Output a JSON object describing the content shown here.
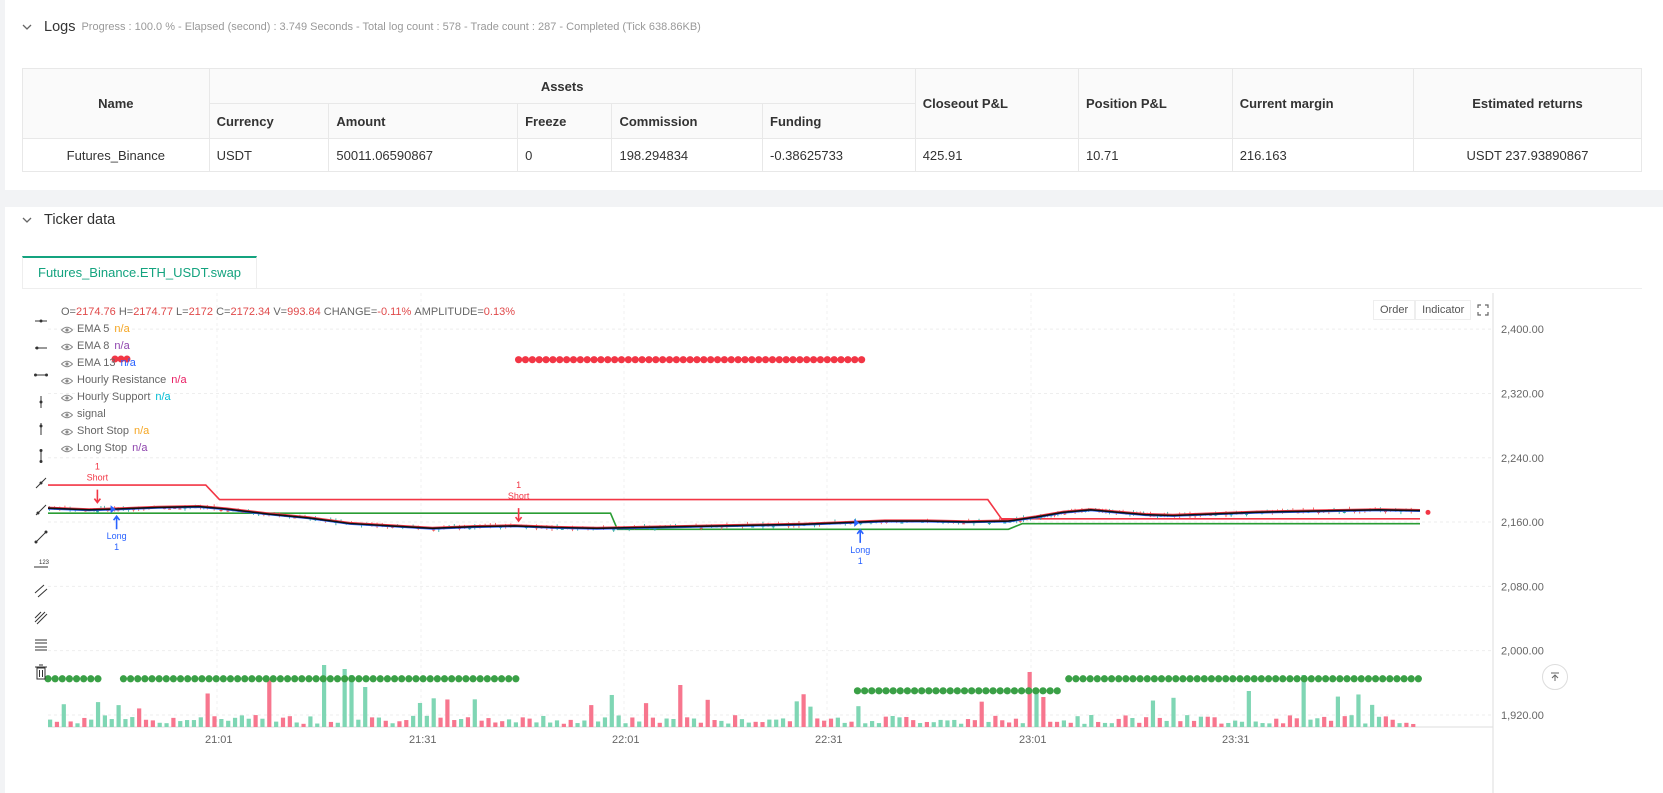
{
  "logs": {
    "title": "Logs",
    "meta": "Progress : 100.0 % - Elapsed (second) : 3.749  Seconds - Total log count : 578 - Trade count : 287 - Completed (Tick 638.86KB)",
    "table": {
      "name_header": "Name",
      "assets_header": "Assets",
      "sub_headers": [
        "Currency",
        "Amount",
        "Freeze",
        "Commission",
        "Funding"
      ],
      "closeout_header": "Closeout P&L",
      "position_header": "Position P&L",
      "margin_header": "Current margin",
      "returns_header": "Estimated returns",
      "row": {
        "name": "Futures_Binance",
        "currency": "USDT",
        "amount": "50011.06590867",
        "freeze": "0",
        "commission": "198.294834",
        "funding": "-0.38625733",
        "closeout": "425.91",
        "position": "10.71",
        "margin": "216.163",
        "returns": "USDT 237.93890867"
      }
    }
  },
  "ticker": {
    "title": "Ticker data",
    "tab": "Futures_Binance.ETH_USDT.swap",
    "buttons": {
      "order": "Order",
      "indicator": "Indicator"
    },
    "ohlc": {
      "o_label": "O=",
      "o": "2174.76",
      "h_label": "H=",
      "h": "2174.77",
      "l_label": "L=",
      "l": "2172",
      "c_label": "C=",
      "c": "2172.34",
      "v_label": "V=",
      "v": "993.84",
      "change_label": "CHANGE=",
      "change": "-0.11%",
      "amp_label": "AMPLITUDE=",
      "amp": "0.13%"
    },
    "legend": [
      {
        "name": "EMA 5",
        "value": "n/a",
        "color": "#f5a623"
      },
      {
        "name": "EMA 8",
        "value": "n/a",
        "color": "#8e44ad"
      },
      {
        "name": "EMA 13",
        "value": "n/a",
        "color": "#2962ff"
      },
      {
        "name": "Hourly Resistance",
        "value": "n/a",
        "color": "#e91e63"
      },
      {
        "name": "Hourly Support",
        "value": "n/a",
        "color": "#00bcd4"
      },
      {
        "name": "signal",
        "value": "",
        "color": "#999999"
      },
      {
        "name": "Short Stop",
        "value": "n/a",
        "color": "#f5a623"
      },
      {
        "name": "Long Stop",
        "value": "n/a",
        "color": "#8e44ad"
      }
    ]
  },
  "chart_data": {
    "type": "candlestick",
    "y_ticks": [
      "2,400.00",
      "2,320.00",
      "2,240.00",
      "2,160.00",
      "2,080.00",
      "2,000.00",
      "1,920.00"
    ],
    "y_tick_values": [
      2400,
      2320,
      2240,
      2160,
      2080,
      2000,
      1920
    ],
    "x_ticks": [
      "21:01",
      "21:31",
      "22:01",
      "22:31",
      "23:01",
      "23:31"
    ],
    "ylim": [
      1905,
      2445
    ],
    "resistance": [
      [
        0,
        2206
      ],
      [
        11.5,
        2206
      ],
      [
        12.5,
        2188
      ],
      [
        68.5,
        2188
      ],
      [
        69.5,
        2164
      ],
      [
        100,
        2164
      ]
    ],
    "support": [
      [
        0,
        2171
      ],
      [
        41,
        2171
      ],
      [
        41.5,
        2151
      ],
      [
        70,
        2151
      ],
      [
        71,
        2158
      ],
      [
        100,
        2158
      ]
    ],
    "price": [
      [
        0,
        2177
      ],
      [
        3,
        2175
      ],
      [
        5,
        2176
      ],
      [
        8,
        2178
      ],
      [
        11,
        2179
      ],
      [
        13,
        2176
      ],
      [
        16,
        2170
      ],
      [
        19,
        2165
      ],
      [
        22,
        2158
      ],
      [
        25,
        2155
      ],
      [
        28,
        2152
      ],
      [
        31,
        2154
      ],
      [
        34,
        2155
      ],
      [
        37,
        2153
      ],
      [
        40,
        2152
      ],
      [
        43,
        2153
      ],
      [
        46,
        2154
      ],
      [
        49,
        2155
      ],
      [
        52,
        2156
      ],
      [
        55,
        2157
      ],
      [
        58,
        2159
      ],
      [
        61,
        2161
      ],
      [
        64,
        2161
      ],
      [
        67,
        2160
      ],
      [
        70,
        2161
      ],
      [
        72,
        2166
      ],
      [
        74,
        2172
      ],
      [
        76,
        2175
      ],
      [
        78,
        2172
      ],
      [
        80,
        2169
      ],
      [
        82,
        2168
      ],
      [
        85,
        2170
      ],
      [
        88,
        2172
      ],
      [
        91,
        2173
      ],
      [
        94,
        2174
      ],
      [
        97,
        2175
      ],
      [
        100,
        2174
      ]
    ],
    "signals": [
      {
        "label": "Short",
        "count": "1",
        "x": 3.6,
        "y": 2178,
        "dir": "down"
      },
      {
        "label": "Long",
        "count": "1",
        "x": 5,
        "y": 2176,
        "dir": "up"
      },
      {
        "label": "Short",
        "count": "1",
        "x": 34.3,
        "y": 2155,
        "dir": "down"
      },
      {
        "label": "Long",
        "count": "1",
        "x": 59.2,
        "y": 2159,
        "dir": "up"
      }
    ],
    "stop_short": {
      "from": 34.3,
      "to": 59.4,
      "y": 2362
    },
    "stop_long_segments": [
      [
        0,
        4
      ],
      [
        5.5,
        34.1
      ],
      [
        59,
        73.7
      ],
      [
        74.4,
        100
      ]
    ],
    "stop_long_y": [
      1965,
      1965,
      1950,
      1965
    ]
  }
}
